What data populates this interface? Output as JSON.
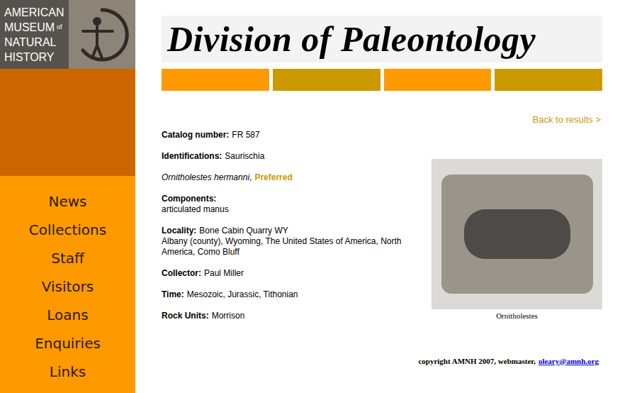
{
  "logo": {
    "lines": [
      "AMERICAN",
      "MUSEUM",
      "NATURAL",
      "HISTORY"
    ],
    "of": "of"
  },
  "header": {
    "title": "Division of Paleontology"
  },
  "sidebar": {
    "items": [
      "News",
      "Collections",
      "Staff",
      "Visitors",
      "Loans",
      "Enquiries",
      "Links"
    ]
  },
  "back_link": "Back to results >",
  "record": {
    "catalog": {
      "label": "Catalog number:",
      "value": "FR 587"
    },
    "identifications": {
      "label": "Identifications:",
      "value": "Saurischia"
    },
    "taxon": {
      "name": "Ornitholestes hermanni",
      "separator": ",",
      "status": "Preferred"
    },
    "components": {
      "label": "Components:",
      "value": "articulated manus"
    },
    "locality": {
      "label": "Locality:",
      "lines": [
        "Bone Cabin Quarry WY",
        "Albany (county), Wyoming, The United States of America, North America, Como Bluff"
      ]
    },
    "collector": {
      "label": "Collector:",
      "value": "Paul Miller"
    },
    "time": {
      "label": "Time:",
      "value": "Mesozoic, Jurassic, Tithonian"
    },
    "rock_units": {
      "label": "Rock Units:",
      "value": "Morrison"
    }
  },
  "image": {
    "caption": "Ornitholestes"
  },
  "footer": {
    "text": "copyright AMNH 2007, webmaster,",
    "email": "oleary@amnh.org"
  }
}
